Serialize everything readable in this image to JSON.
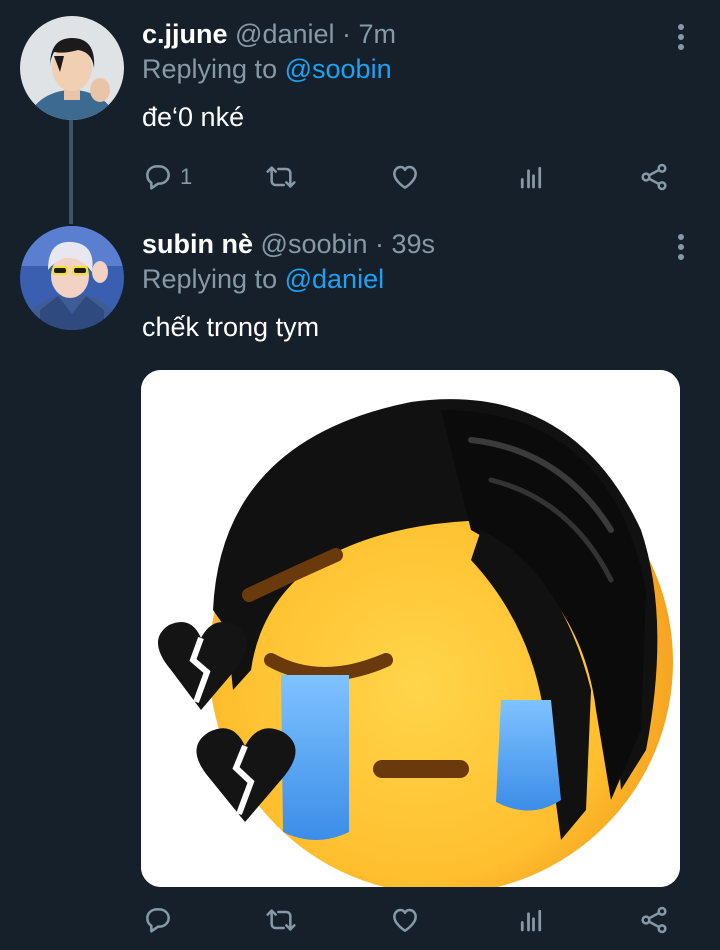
{
  "tweets": [
    {
      "name": "c.jjune",
      "handle": "@daniel",
      "time": "· 7m",
      "replying_prefix": "Replying to",
      "replying_to": "@soobin",
      "text": "đe‘0 nké",
      "reply_count": "1"
    },
    {
      "name": "subin nè",
      "handle": "@soobin",
      "time": "· 39s",
      "replying_prefix": "Replying to",
      "replying_to": "@daniel",
      "text": "chếk trong tym",
      "reply_count": ""
    }
  ],
  "icons": [
    "reply-icon",
    "retweet-icon",
    "like-icon",
    "analytics-icon",
    "share-icon",
    "more-icon"
  ],
  "colors": {
    "background": "#15202b",
    "secondary_text": "#8899a6",
    "link": "#1da1f2",
    "thread_line": "#3d5466"
  }
}
